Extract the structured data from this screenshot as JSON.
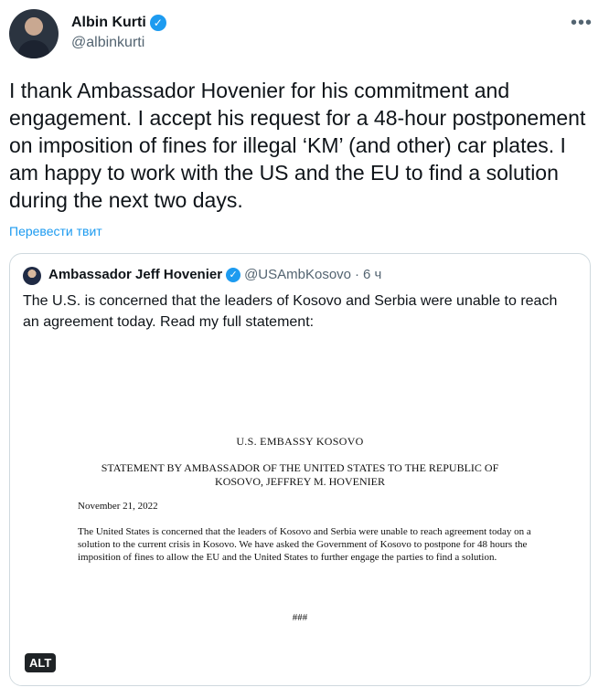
{
  "author": {
    "name": "Albin Kurti",
    "handle": "@albinkurti",
    "verified_icon": "verified-badge-icon"
  },
  "menu": {
    "more_label": "•••"
  },
  "tweet": {
    "text": "I thank Ambassador Hovenier for his commitment and engagement. I accept his request for a 48-hour postponement on imposition of fines for illegal ‘KM’ (and other) car plates. I am happy to work with the US and the EU to find a solution during the next two days.",
    "translate_label": "Перевести твит"
  },
  "quoted": {
    "name": "Ambassador Jeff Hovenier",
    "handle": "@USAmbKosovo",
    "separator": "·",
    "time": "6 ч",
    "text": "The U.S. is concerned that the leaders of Kosovo and Serbia were unable to reach an agreement today. Read my full statement:",
    "alt_label": "ALT",
    "document": {
      "title": "U.S. EMBASSY KOSOVO",
      "heading": "STATEMENT BY AMBASSADOR OF THE UNITED STATES TO THE REPUBLIC OF KOSOVO, JEFFREY M. HOVENIER",
      "date": "November 21, 2022",
      "body": "The United States is concerned that the leaders of Kosovo and Serbia were unable to reach agreement today on a solution to the current crisis in Kosovo.  We have asked the Government of Kosovo to postpone for 48 hours the imposition of fines to allow the EU and the United States to further engage the parties to find a solution.",
      "end_mark": "###"
    }
  },
  "colors": {
    "accent": "#1d9bf0",
    "text": "#0f1419",
    "secondary": "#536471",
    "border": "#cfd9de"
  }
}
